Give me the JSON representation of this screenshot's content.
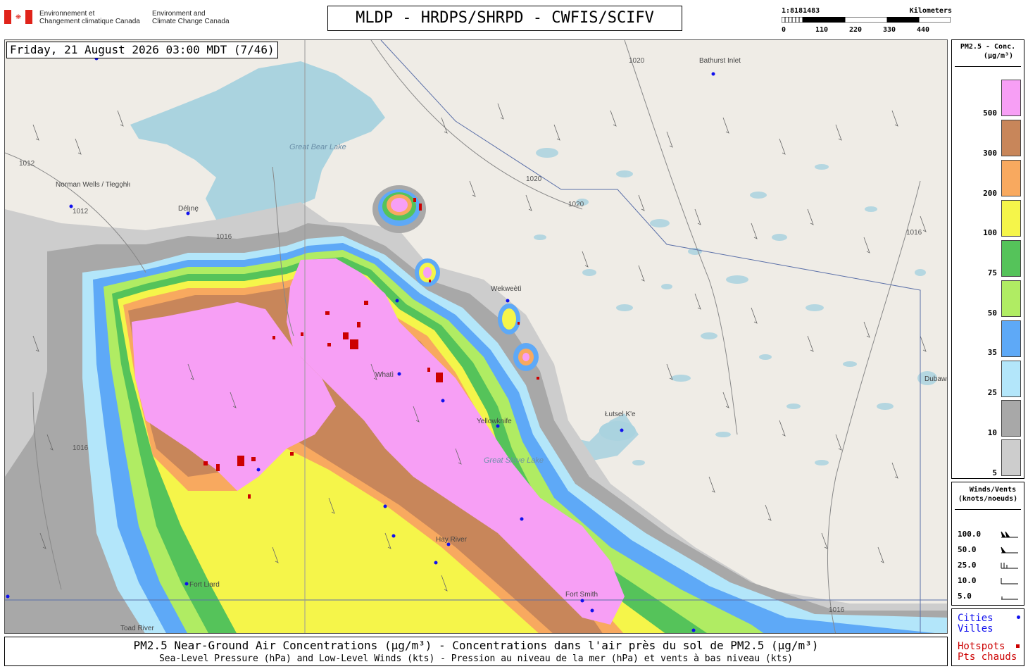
{
  "header": {
    "dept_fr": "Environnement et\nChangement climatique Canada",
    "dept_en": "Environment and\nClimate Change Canada",
    "title": "MLDP - HRDPS/SHRPD - CWFIS/SCIFV",
    "scale_ratio": "1:8181483",
    "scale_unit": "Kilometers",
    "scale_ticks": [
      "0",
      "110",
      "220",
      "330",
      "440"
    ]
  },
  "map": {
    "timestamp": "Friday, 21 August 2026 03:00 MDT (7/46)",
    "lakes": [
      "Great Bear Lake",
      "Great Slave Lake"
    ],
    "cities": [
      {
        "name": "Bathurst Inlet"
      },
      {
        "name": "Norman Wells / Tłegǫhłı"
      },
      {
        "name": "Délı̨nę"
      },
      {
        "name": "Wekweètì"
      },
      {
        "name": "Whatì"
      },
      {
        "name": "Yellowknife"
      },
      {
        "name": "Łutsel K'e"
      },
      {
        "name": "Hay River"
      },
      {
        "name": "Fort Smith"
      },
      {
        "name": "Fort Liard"
      },
      {
        "name": "Toad River"
      },
      {
        "name": "Dubawnt Lake"
      }
    ],
    "isobars": [
      "1012",
      "1016",
      "1020"
    ],
    "colors": {
      "land": "#efece6",
      "water": "#aad3df",
      "pink": "#f79ff5",
      "brown": "#c8865a",
      "orange": "#f8a95f",
      "yellow": "#f5f54a",
      "green_dark": "#55c35a",
      "green_light": "#b0ec63",
      "blue": "#5ea9f7",
      "blue_light": "#b3e6fa",
      "gray_dark": "#a8a8a8",
      "gray_light": "#cdcdcd",
      "hotspot": "#cc0000",
      "city": "#1010ee"
    }
  },
  "legend": {
    "pm_title": "PM2.5 - Conc.",
    "pm_unit": "(µg/m³)",
    "pm_levels": [
      "500",
      "300",
      "200",
      "100",
      "75",
      "50",
      "35",
      "25",
      "10",
      "5"
    ],
    "wind_title": "Winds/Vents",
    "wind_unit": "(knots/noeuds)",
    "wind_levels": [
      "100.0",
      "50.0",
      "25.0",
      "10.0",
      "5.0"
    ],
    "cities_en": "Cities",
    "cities_fr": "Villes",
    "hotspots_en": "Hotspots",
    "hotspots_fr": "Pts chauds"
  },
  "caption": {
    "line1": "PM2.5 Near-Ground Air Concentrations (µg/m³) - Concentrations dans l'air près du sol de PM2.5 (µg/m³)",
    "line2": "Sea-Level Pressure (hPa) and Low-Level Winds (kts) - Pression au niveau de la mer (hPa) et vents à bas niveau (kts)"
  }
}
